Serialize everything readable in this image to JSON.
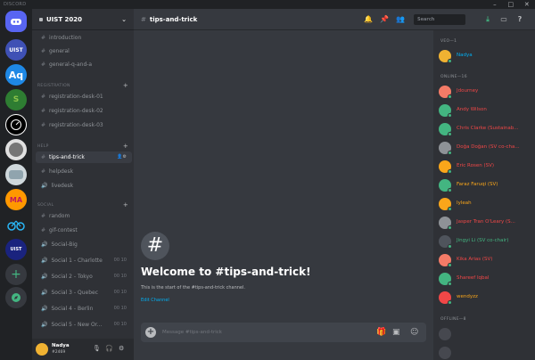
{
  "window": {
    "title": "DISCORD"
  },
  "guild": {
    "name": "UIST 2020"
  },
  "channels": {
    "top": [
      "introduction",
      "general",
      "general-q-and-a"
    ],
    "registration": {
      "label": "REGISTRATION",
      "items": [
        "registration-desk-01",
        "registration-desk-02",
        "registration-desk-03"
      ]
    },
    "help": {
      "label": "HELP",
      "items": [
        "tips-and-trick",
        "helpdesk",
        "livedesk"
      ]
    },
    "social": {
      "label": "SOCIAL",
      "items": [
        "random",
        "gif-contest"
      ]
    },
    "voice": [
      {
        "name": "Social-Big",
        "limit": ""
      },
      {
        "name": "Social 1 - Charlotte",
        "limit": "00 10"
      },
      {
        "name": "Social 2 - Tokyo",
        "limit": "00 10"
      },
      {
        "name": "Social 3 - Quebec",
        "limit": "00 10"
      },
      {
        "name": "Social 4 - Berlin",
        "limit": "00 10"
      },
      {
        "name": "Social 5 - New Or...",
        "limit": "00 10"
      }
    ]
  },
  "user": {
    "name": "Nadya",
    "disc": "#2469"
  },
  "header": {
    "channel": "tips-and-trick",
    "search_placeholder": "Search"
  },
  "welcome": {
    "title": "Welcome to #tips-and-trick!",
    "subtitle": "This is the start of the #tips-and-trick channel.",
    "edit": "Edit Channel"
  },
  "composer": {
    "placeholder": "Message #tips-and-trick"
  },
  "members": {
    "sections": [
      {
        "label": "VEO—1",
        "items": [
          {
            "name": "Nadya",
            "color": "#00b0f4",
            "avatar": "#f0b232"
          }
        ]
      },
      {
        "label": "ONLINE—16",
        "items": [
          {
            "name": "Jdourney",
            "color": "#f04747",
            "avatar": "#f47b67"
          },
          {
            "name": "Andy Wilson",
            "color": "#f04747",
            "avatar": "#43b581"
          },
          {
            "name": "Chris Clarke (Sustainab...",
            "color": "#f04747",
            "avatar": "#43b581"
          },
          {
            "name": "Doğa Doğan (SV co-cha...",
            "color": "#f04747",
            "avatar": "#8e9297"
          },
          {
            "name": "Eric Rosen (SV)",
            "color": "#f04747",
            "avatar": "#faa61a"
          },
          {
            "name": "Faraz Faruqi (SV)",
            "color": "#faa61a",
            "avatar": "#43b581"
          },
          {
            "name": "Iyleah",
            "color": "#faa61a",
            "avatar": "#faa61a"
          },
          {
            "name": "Jasper Tran O'Leary (S...",
            "color": "#f04747",
            "avatar": "#8e9297"
          },
          {
            "name": "Jingyi Li (SV co-chair)",
            "color": "#43b581",
            "avatar": "#4f545c"
          },
          {
            "name": "Kika Arias (SV)",
            "color": "#f04747",
            "avatar": "#f47b67"
          },
          {
            "name": "Shareef Iqbal",
            "color": "#f04747",
            "avatar": "#43b581"
          },
          {
            "name": "wendyzz",
            "color": "#faa61a",
            "avatar": "#f04747"
          }
        ]
      },
      {
        "label": "OFFLINE—8",
        "items": []
      }
    ]
  },
  "colors": {
    "accent": "#7289da",
    "link": "#00b0f4",
    "online": "#43b581"
  }
}
